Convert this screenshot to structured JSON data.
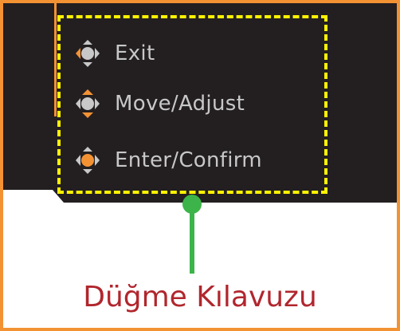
{
  "guide_items": [
    {
      "icon": "joystick-left-icon",
      "label": "Exit"
    },
    {
      "icon": "joystick-up-down-icon",
      "label": "Move/Adjust"
    },
    {
      "icon": "joystick-press-icon",
      "label": "Enter/Confirm"
    }
  ],
  "caption": "Düğme Kılavuzu",
  "colors": {
    "frame": "#f39233",
    "panel": "#231f20",
    "highlight": "#fff200",
    "connector": "#3cb449",
    "caption": "#b1262d",
    "icon_active": "#f39233",
    "icon_inactive": "#c8c8c8"
  }
}
